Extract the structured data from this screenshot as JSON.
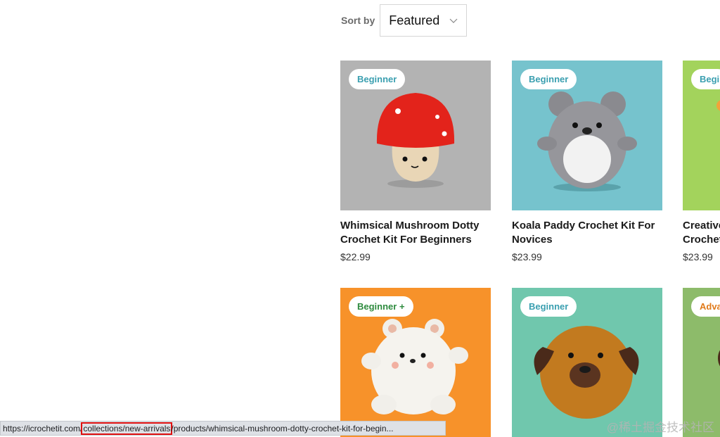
{
  "sort": {
    "label": "Sort by",
    "selected": "Featured"
  },
  "products": [
    {
      "badge": "Beginner",
      "badge_color": "#3a9fb0",
      "bg": "#b3b3b3",
      "title_line1": "Whimsical Mushroom Dotty",
      "title_line2": "Crochet Kit For Beginners",
      "price": "$22.99",
      "icon": "mushroom-icon"
    },
    {
      "badge": "Beginner",
      "badge_color": "#3a9fb0",
      "bg": "#76c3cd",
      "title_line1": "Koala Paddy Crochet Kit For",
      "title_line2": "Novices",
      "price": "$23.99",
      "icon": "koala-icon"
    },
    {
      "badge": "Begi",
      "badge_color": "#3a9fb0",
      "bg": "#a3d35c",
      "title_line1": "Creative",
      "title_line2": "Crochet",
      "price": "$23.99",
      "icon": "toy-icon"
    },
    {
      "badge": "Beginner +",
      "badge_color": "#2e8b3e",
      "bg": "#f7922a",
      "title_line1": "",
      "title_line2": "",
      "price": "",
      "icon": "bear-icon"
    },
    {
      "badge": "Beginner",
      "badge_color": "#3a9fb0",
      "bg": "#70c7ad",
      "title_line1": "",
      "title_line2": "",
      "price": "",
      "icon": "pug-icon"
    },
    {
      "badge": "Adva",
      "badge_color": "#e07a1a",
      "bg": "#8dbb6a",
      "title_line1": "",
      "title_line2": "",
      "price": "",
      "icon": "toy-icon"
    }
  ],
  "status_bar": {
    "prefix": "https://icrochetit.com/",
    "highlight": "collections/new-arrivals",
    "suffix": "/products/whimsical-mushroom-dotty-crochet-kit-for-begin..."
  },
  "watermark": "@稀土掘金技术社区"
}
